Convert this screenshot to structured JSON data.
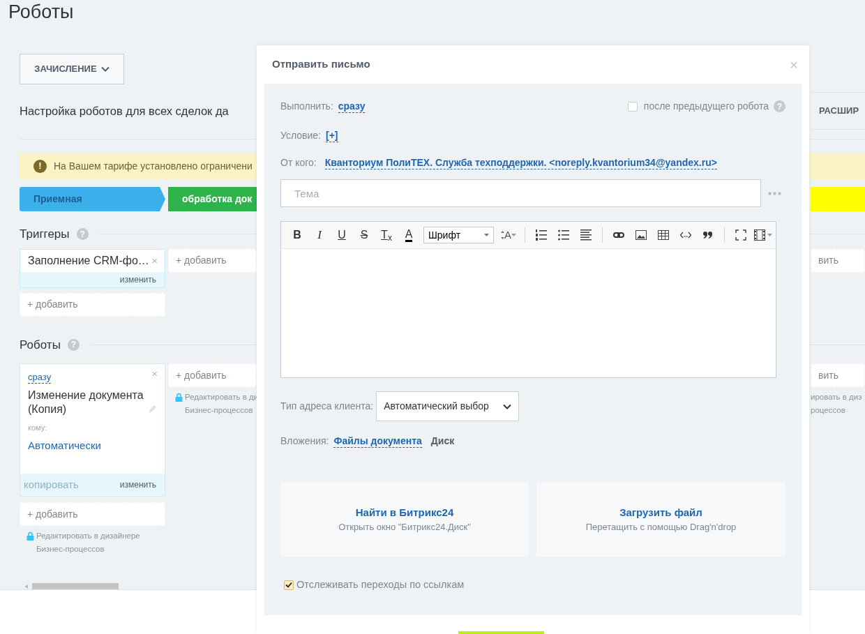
{
  "page_title": "Роботы",
  "category_button": {
    "label": "ЗАЧИСЛЕНИЕ"
  },
  "settings_text": "Настройка роботов для всех сделок да",
  "extended_button": {
    "label": "РАСШИР"
  },
  "alert": {
    "icon": "!",
    "text": "На Вашем тарифе установлено ограничени"
  },
  "sections": {
    "triggers": {
      "title": "Триггеры",
      "help": "?"
    },
    "robots": {
      "title": "Роботы",
      "help": "?"
    }
  },
  "columns": [
    {
      "stage": {
        "label": "Приемная",
        "color": "#3bb0ec"
      },
      "triggers": [
        {
          "title": "Заполнение CRM-фо…",
          "close": "×",
          "edit": "изменить"
        }
      ],
      "trigger_add": "+ добавить",
      "robots": [
        {
          "delay": "сразу",
          "title": "Изменение документа (Копия)",
          "recipient_label": "кому:",
          "recipient": "Автоматически",
          "copy": {
            "label": "копировать",
            "disabled": true
          },
          "edit": "изменить",
          "close": "×"
        }
      ],
      "robot_add": "+ добавить",
      "lock": true,
      "designer_link": "Редактировать в дизайнере\nБизнес-процессов"
    },
    {
      "stage": {
        "label": "обработка док",
        "color": "#2db34a"
      },
      "trigger_add": "+ добавить",
      "robot_add": "+ добавить",
      "lock": true,
      "designer_link": "Редактировать в ди\nБизнес-процессов"
    },
    {
      "stage": {
        "color": "#ffff00"
      },
      "trigger_add": "вить",
      "robot_add": "вить",
      "lock": false,
      "designer_link": "ировать в диз\nроцессов"
    }
  ],
  "dialog": {
    "title": "Отправить письмо",
    "close": "×",
    "execute": {
      "label": "Выполнить:",
      "value": "сразу"
    },
    "after_previous": {
      "label": "после предыдущего робота",
      "checked": false,
      "help": "?"
    },
    "condition": {
      "label": "Условие:",
      "value": "[+]"
    },
    "sender": {
      "label": "От кого:",
      "value": "Кванториум ПолиТЕХ. Служба техподдержки. <noreply.kvantorium34@yandex.ru>"
    },
    "subject": {
      "placeholder": "Тема"
    },
    "toolbar": [
      {
        "kind": "bold",
        "label": "B"
      },
      {
        "kind": "italic",
        "label": "I"
      },
      {
        "kind": "underline",
        "label": "U"
      },
      {
        "kind": "strike",
        "label": "S"
      },
      {
        "kind": "clear",
        "label": "T$_{x}$"
      },
      {
        "kind": "color",
        "label": "A"
      },
      {
        "kind": "font",
        "label": "Шрифт"
      },
      {
        "kind": "size",
        "label": "A"
      }
    ],
    "address_type": {
      "label": "Тип адреса клиента:",
      "value": "Автоматический выбор"
    },
    "attachments": {
      "label": "Вложения:",
      "sources": [
        {
          "label": "Файлы документа",
          "selected": true
        },
        {
          "label": "Диск",
          "selected": false
        }
      ]
    },
    "upload_zones": [
      {
        "title": "Найти в Битрикс24",
        "hint": "Открыть окно \"Битрикс24.Диск\""
      },
      {
        "title": "Загрузить файл",
        "hint": "Перетащить с помощью Drag'n'drop"
      }
    ],
    "track_links": {
      "label": "Отслеживать переходы по ссылкам",
      "checked": true
    }
  }
}
